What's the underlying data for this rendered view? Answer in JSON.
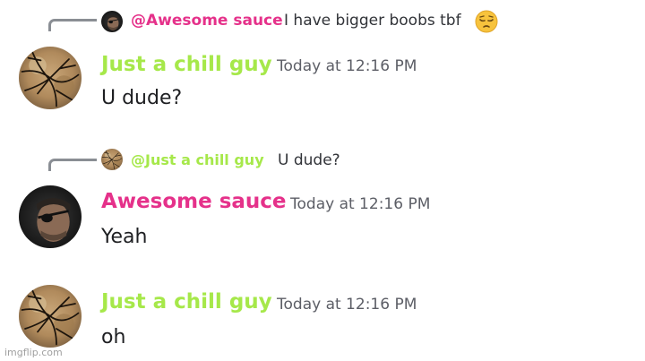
{
  "colors": {
    "chill_guy": "#a6e84a",
    "awesome_sauce": "#e5318a",
    "reply_line": "#8a8e94",
    "timestamp": "#5c5e66"
  },
  "messages": [
    {
      "reply": {
        "avatar_icon": "eyepatch-avatar-icon",
        "mention": "@Awesome sauce",
        "text": "I have bigger boobs tbf",
        "emoji": "pensive-face-emoji"
      },
      "avatar_icon": "branches-avatar-icon",
      "username": "Just a chill guy",
      "timestamp": "Today at 12:16 PM",
      "content": "U dude?"
    },
    {
      "reply": {
        "avatar_icon": "branches-avatar-icon",
        "mention": "@Just a chill guy",
        "text": "U dude?"
      },
      "avatar_icon": "eyepatch-avatar-icon",
      "username": "Awesome sauce",
      "timestamp": "Today at 12:16 PM",
      "content": "Yeah"
    },
    {
      "avatar_icon": "branches-avatar-icon",
      "username": "Just a chill guy",
      "timestamp": "Today at 12:16 PM",
      "content": "oh"
    }
  ],
  "watermark": "imgflip.com"
}
